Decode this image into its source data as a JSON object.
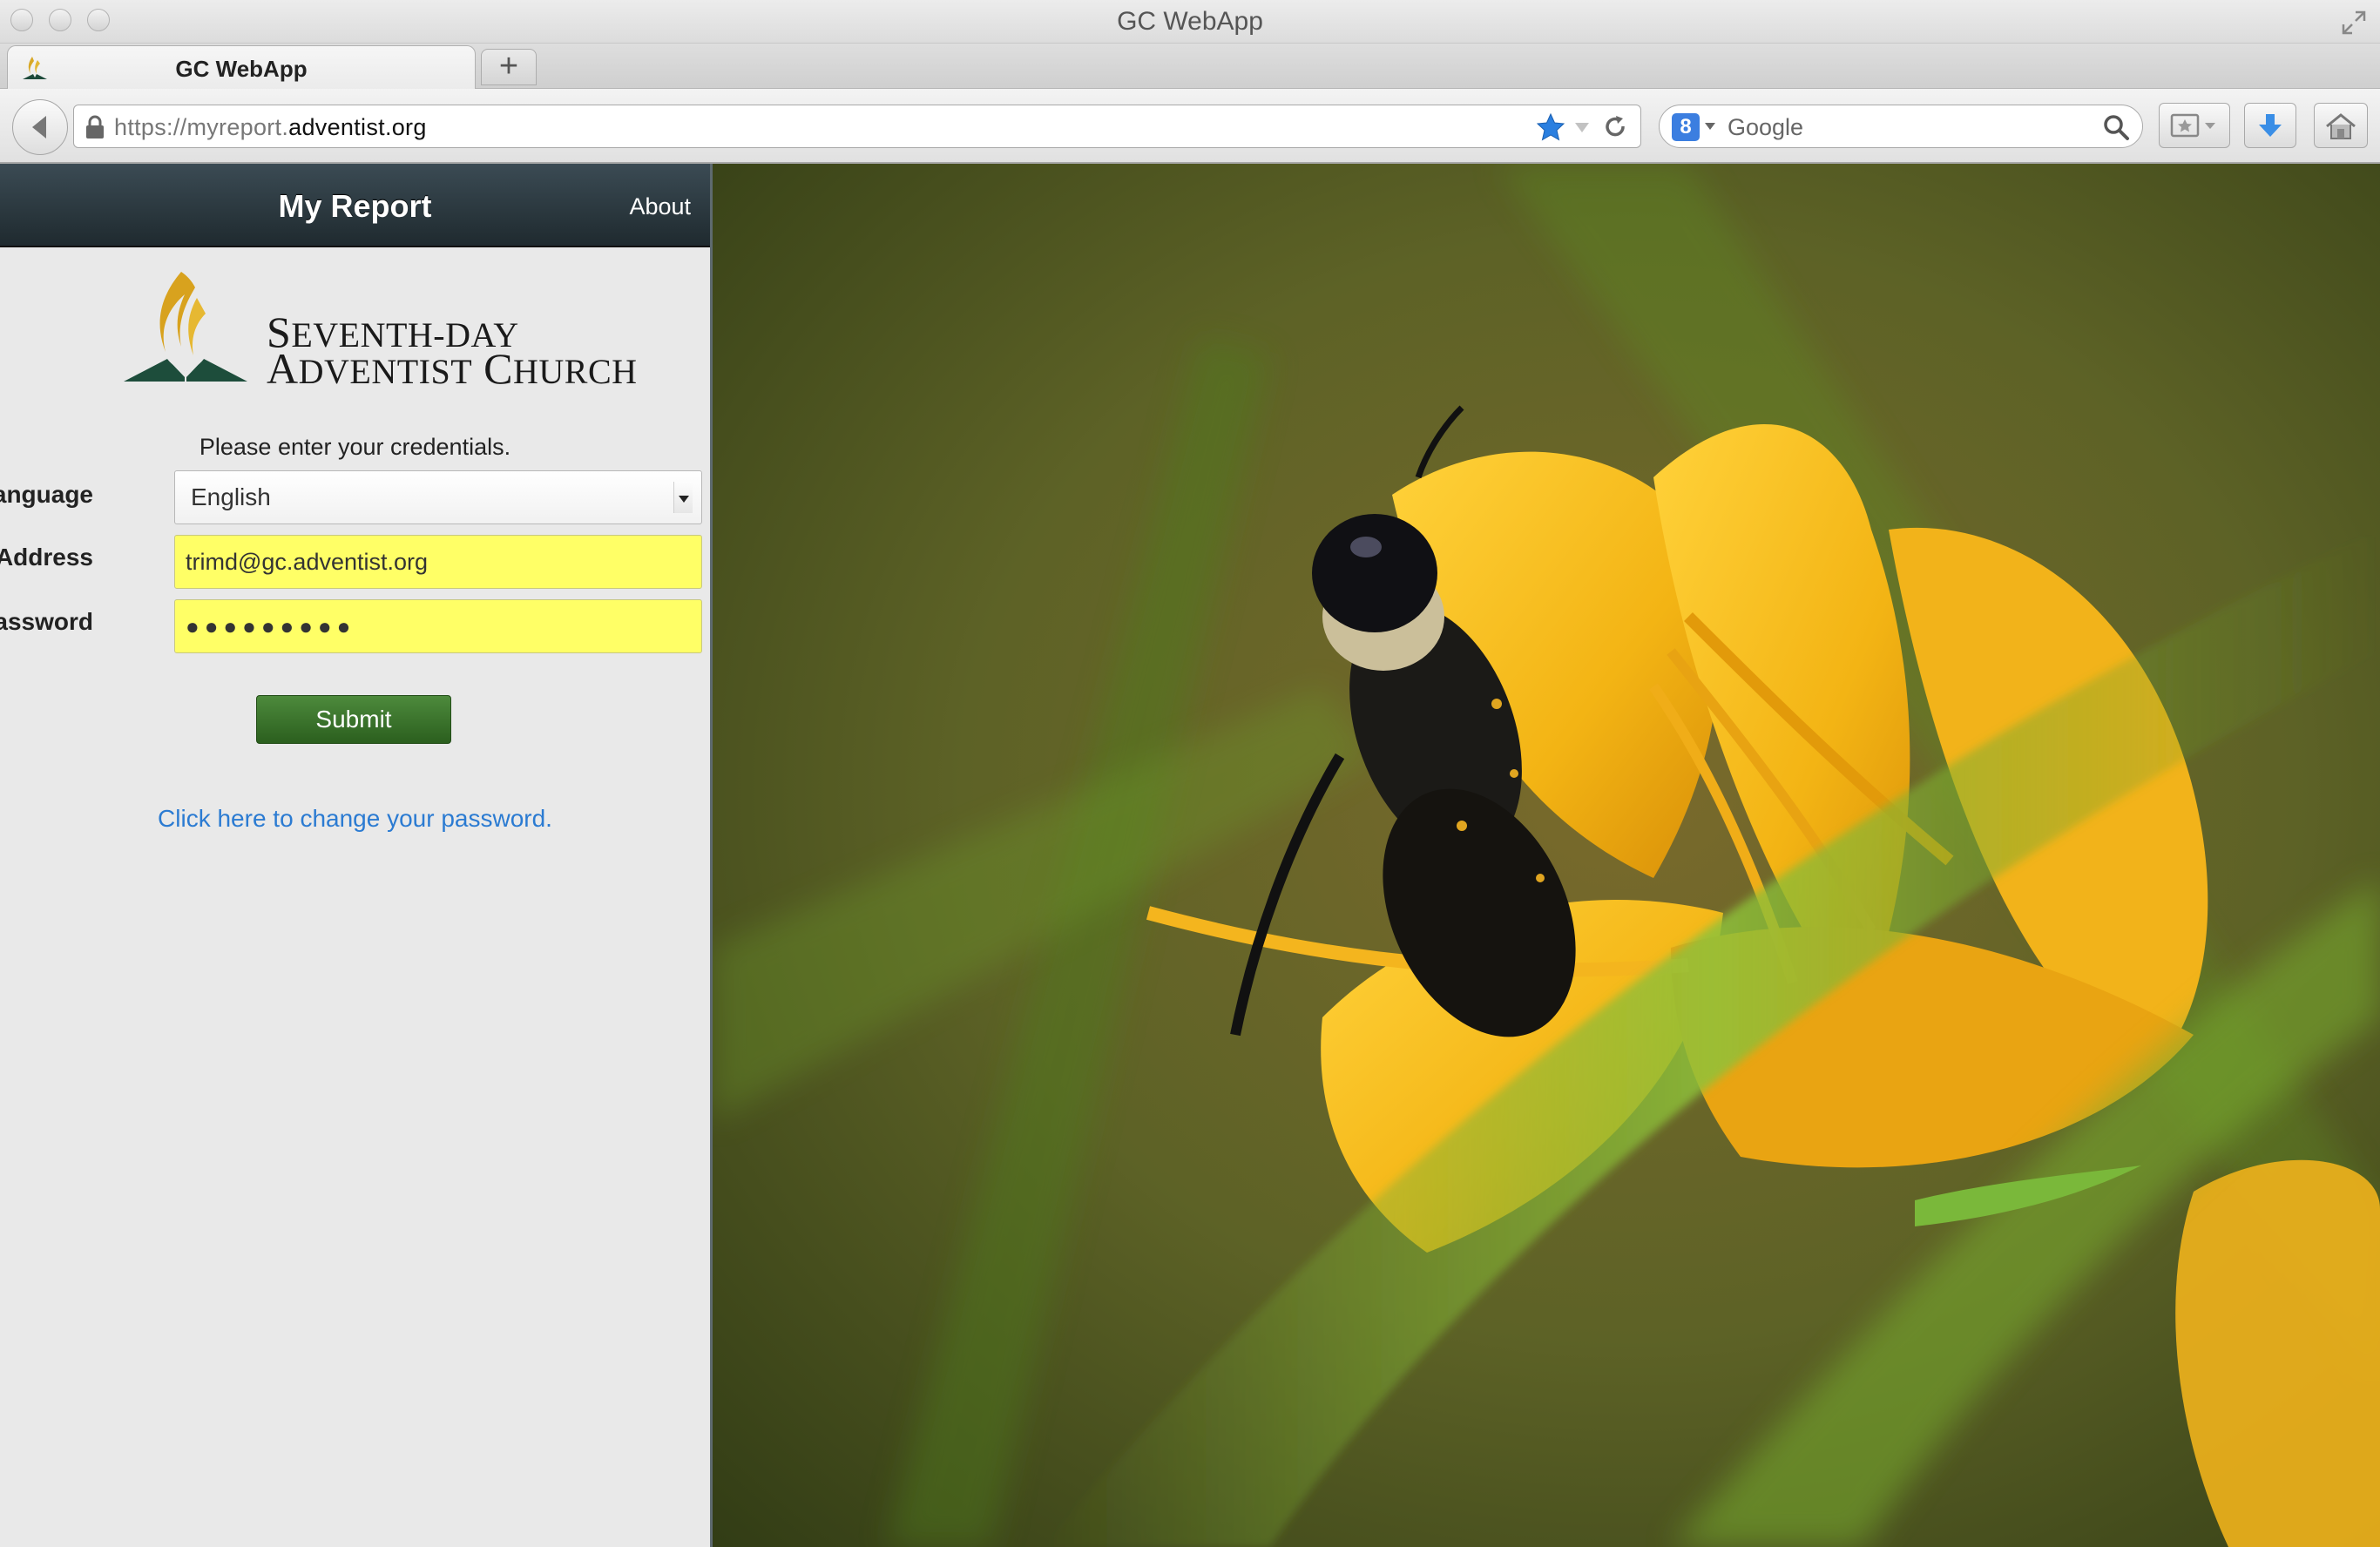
{
  "window": {
    "title": "GC WebApp"
  },
  "tabs": [
    {
      "label": "GC WebApp",
      "favicon": "sda-flame-icon",
      "active": true
    }
  ],
  "toolbar": {
    "new_tab_label": "+",
    "url_prefix": "https://myreport.",
    "url_domain": "adventist.org",
    "search_placeholder": "Google",
    "search_engine_icon": "8",
    "icons": [
      "back-arrow-icon",
      "lock-icon",
      "star-icon",
      "reload-icon",
      "google-icon",
      "magnifier-icon",
      "bookmarks-icon",
      "download-icon",
      "home-icon"
    ]
  },
  "app": {
    "title": "My Report",
    "about_label": "About",
    "logo": {
      "line1_first": "S",
      "line1_rest": "EVENTH-DAY",
      "line2_first": "A",
      "line2_mid": "DVENTIST",
      "line2_first2": " C",
      "line2_rest": "HURCH"
    },
    "prompt": "Please enter your credentials.",
    "form": {
      "language_label": "Language",
      "language_value": "English",
      "email_label": "Email Address",
      "email_value": "trimd@gc.adventist.org",
      "password_label": "Password",
      "password_value": "●●●●●●●●●",
      "submit_label": "Submit"
    },
    "change_password_link": "Click here to change your password."
  },
  "colors": {
    "header_bg": "#2a373d",
    "autofill_yellow": "#ffff66",
    "submit_green": "#3c7a2e",
    "link_blue": "#2b7bd2",
    "star_blue": "#2a7fe0"
  }
}
